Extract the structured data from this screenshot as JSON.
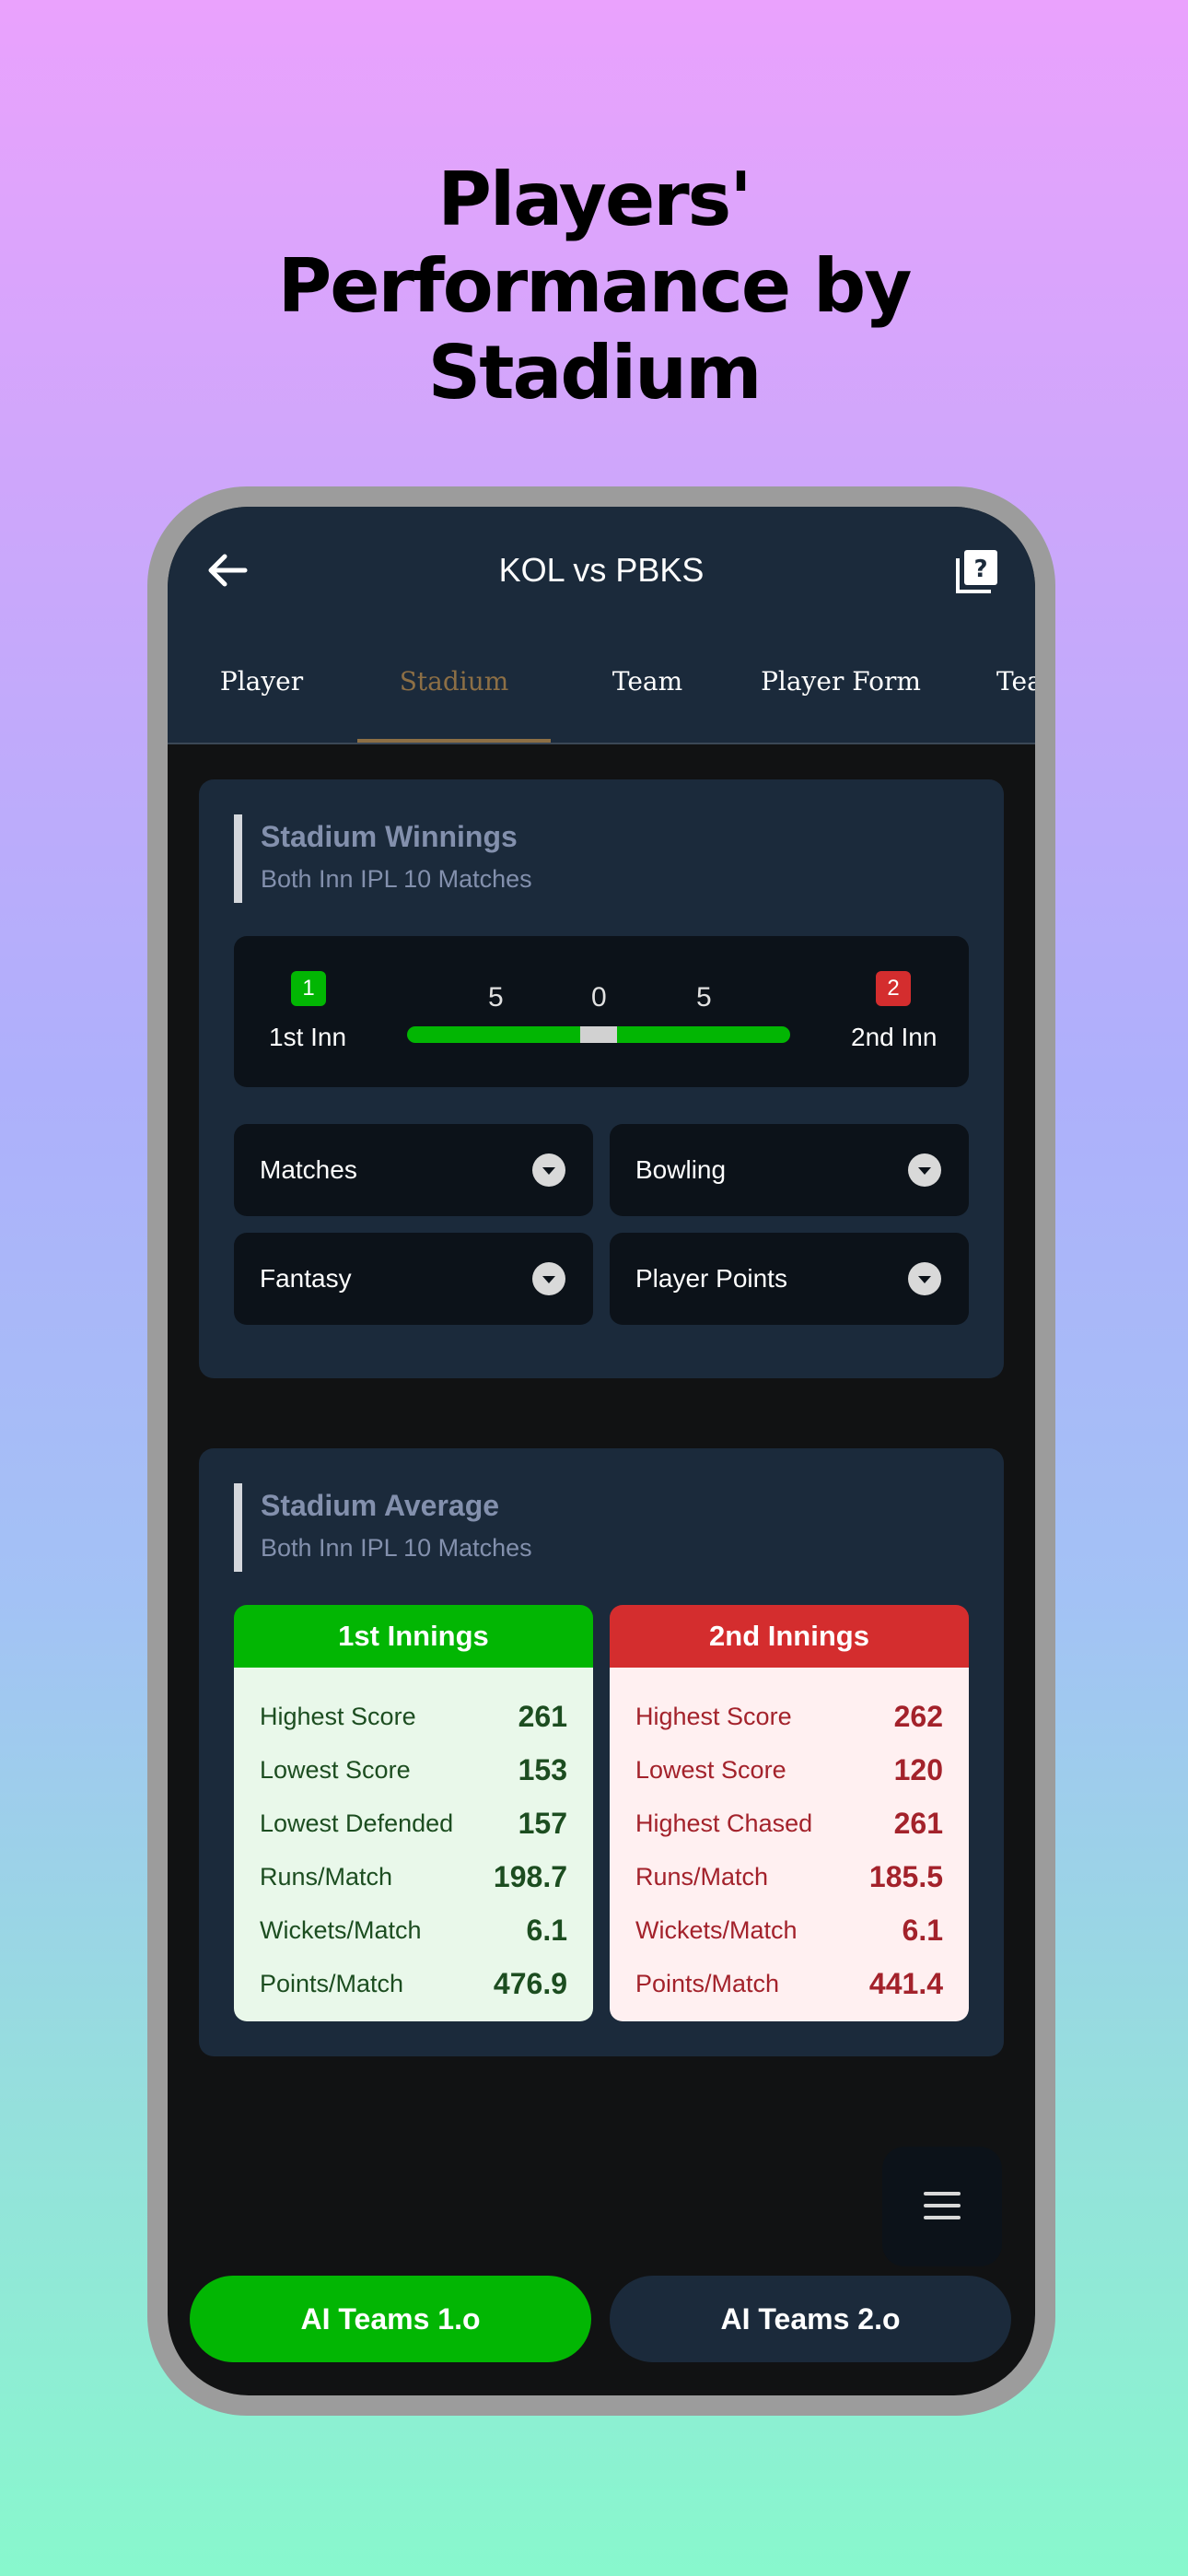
{
  "headline": [
    "Players'",
    "Performance by",
    "Stadium"
  ],
  "appbar": {
    "title": "KOL vs PBKS"
  },
  "tabs": [
    {
      "label": "Player"
    },
    {
      "label": "Stadium",
      "active": true
    },
    {
      "label": "Team"
    },
    {
      "label": "Player Form"
    },
    {
      "label": "Tea"
    }
  ],
  "winnings": {
    "title": "Stadium Winnings",
    "subtitle": "Both Inn IPL 10 Matches",
    "first": {
      "badge": "1",
      "label": "1st Inn",
      "count": "5"
    },
    "draw": "0",
    "second": {
      "badge": "2",
      "label": "2nd Inn",
      "count": "5"
    },
    "filters": [
      "Matches",
      "Bowling",
      "Fantasy",
      "Player Points"
    ]
  },
  "average": {
    "title": "Stadium Average",
    "subtitle": "Both Inn IPL 10 Matches",
    "first": {
      "header": "1st Innings",
      "rows": [
        {
          "label": "Highest Score",
          "value": "261"
        },
        {
          "label": "Lowest Score",
          "value": "153"
        },
        {
          "label": "Lowest Defended",
          "value": "157"
        },
        {
          "label": "Runs/Match",
          "value": "198.7"
        },
        {
          "label": "Wickets/Match",
          "value": "6.1"
        },
        {
          "label": "Points/Match",
          "value": "476.9"
        }
      ]
    },
    "second": {
      "header": "2nd Innings",
      "rows": [
        {
          "label": "Highest Score",
          "value": "262"
        },
        {
          "label": "Lowest Score",
          "value": "120"
        },
        {
          "label": "Highest Chased",
          "value": "261"
        },
        {
          "label": "Runs/Match",
          "value": "185.5"
        },
        {
          "label": "Wickets/Match",
          "value": "6.1"
        },
        {
          "label": "Points/Match",
          "value": "441.4"
        }
      ]
    }
  },
  "buttons": {
    "ai1": "AI Teams 1.o",
    "ai2": "AI Teams 2.o"
  },
  "colors": {
    "green": "#02b603",
    "red": "#d42d2e",
    "accent": "#8d6f45",
    "panel": "#1b2a3b"
  },
  "icons": [
    "back-arrow-icon",
    "help-book-icon",
    "chevron-down-icon",
    "menu-icon"
  ]
}
